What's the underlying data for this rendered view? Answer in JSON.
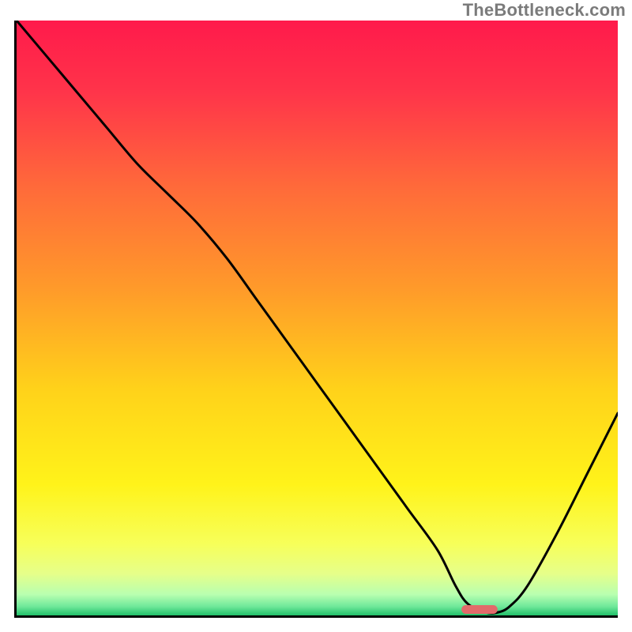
{
  "watermark": "TheBottleneck.com",
  "colors": {
    "axis": "#000000",
    "curve": "#000000",
    "marker": "#e26a6a",
    "gradient_stops": [
      {
        "offset": 0.0,
        "color": "#ff1a4b"
      },
      {
        "offset": 0.12,
        "color": "#ff344a"
      },
      {
        "offset": 0.28,
        "color": "#ff6a3a"
      },
      {
        "offset": 0.45,
        "color": "#ff9a2a"
      },
      {
        "offset": 0.62,
        "color": "#ffd21a"
      },
      {
        "offset": 0.78,
        "color": "#fff31a"
      },
      {
        "offset": 0.88,
        "color": "#f7ff5a"
      },
      {
        "offset": 0.93,
        "color": "#e6ff8a"
      },
      {
        "offset": 0.965,
        "color": "#b8ffb0"
      },
      {
        "offset": 0.985,
        "color": "#6fe89a"
      },
      {
        "offset": 1.0,
        "color": "#22c06a"
      }
    ]
  },
  "chart_data": {
    "type": "line",
    "title": "",
    "xlabel": "",
    "ylabel": "",
    "xlim": [
      0,
      100
    ],
    "ylim": [
      0,
      100
    ],
    "grid": false,
    "legend": false,
    "series": [
      {
        "name": "curve",
        "x": [
          0,
          5,
          10,
          15,
          20,
          25,
          30,
          35,
          40,
          45,
          50,
          55,
          60,
          65,
          70,
          73,
          75,
          78,
          80,
          82,
          85,
          90,
          95,
          100
        ],
        "y": [
          100,
          94,
          88,
          82,
          76,
          71,
          66,
          60,
          53,
          46,
          39,
          32,
          25,
          18,
          11,
          5,
          2,
          0.5,
          0.5,
          1.5,
          5,
          14,
          24,
          34
        ]
      }
    ],
    "marker": {
      "x_start": 74,
      "x_end": 80,
      "y": 1,
      "color": "#e26a6a"
    },
    "annotations": []
  }
}
